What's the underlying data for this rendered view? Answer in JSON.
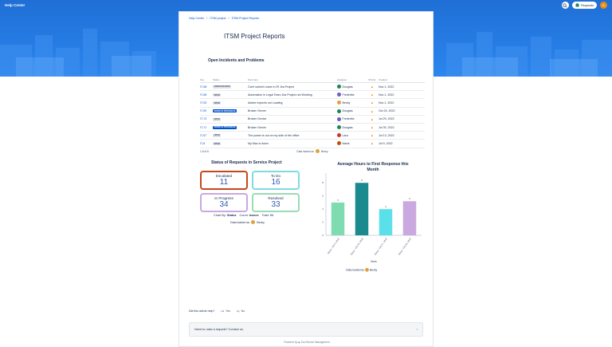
{
  "header": {
    "title": "Help Center",
    "requests_label": "Requests",
    "avatar_initial": "B"
  },
  "breadcrumb": [
    "Help Center",
    "ITSM project",
    "ITSM Project Reports"
  ],
  "page_title": "ITSM Project Reports",
  "table": {
    "title": "Open Incidents and Problems",
    "columns": [
      "Key",
      "Status",
      "Summary",
      "Assignee",
      "Priority",
      "Created"
    ],
    "rows": [
      {
        "key": "IT-98",
        "status": "Under review",
        "summary": "Can't submit Leave in IR Jira Project",
        "assignee": "Douglas",
        "created": "Nov 1, 2022"
      },
      {
        "key": "IT-96",
        "status": "Open",
        "summary": "Automation in Legal Team Jira Project not Working",
        "assignee": "Frederike",
        "created": "Nov 1, 2022"
      },
      {
        "key": "IT-93",
        "status": "Open",
        "summary": "Adobe expects not Loading",
        "assignee": "Becky",
        "created": "Nov 1, 2022"
      },
      {
        "key": "IT-90",
        "status": "Work in progress",
        "summary": "Broken Server",
        "assignee": "Douglas",
        "created": "Oct 24, 2022"
      },
      {
        "key": "IT-73",
        "status": "Open",
        "summary": "Broken Device",
        "assignee": "Frederike",
        "created": "Jul 29, 2022"
      },
      {
        "key": "IT-71",
        "status": "Work in progress",
        "summary": "Broken Server",
        "assignee": "Douglas",
        "created": "Jul 30, 2022"
      },
      {
        "key": "IT-57",
        "status": "Open",
        "summary": "The power is out on my side of the office",
        "assignee": "Lara",
        "created": "Jul 13, 2022"
      },
      {
        "key": "IT-8",
        "status": "Open",
        "summary": "My Mac is down",
        "assignee": "Maria",
        "created": "Jul 9, 2022"
      }
    ],
    "paging": "1-8 of 8",
    "loaded_text": "Data loaded as",
    "loaded_user": "Becky"
  },
  "assignee_colors": {
    "Douglas": "#1f845a",
    "Frederike": "#6e5dc6",
    "Becky": "#e2a03f",
    "Lara": "#c9372c",
    "Maria": "#c25100"
  },
  "status_summary": {
    "title": "Status of Requests in Service Project",
    "boxes": [
      {
        "label": "Escalated",
        "value": "11",
        "color": "#c4471e"
      },
      {
        "label": "To Do",
        "value": "16",
        "color": "#7fdbe0"
      },
      {
        "label": "In Progress",
        "value": "34",
        "color": "#c9a9e0"
      },
      {
        "label": "Resolved",
        "value": "33",
        "color": "#9adcb5"
      }
    ],
    "chart_by_label": "Chart By:",
    "chart_by_value": "Status",
    "count_label": "Count:",
    "count_value": "Issues",
    "total_label": "Total:",
    "total_value": "94",
    "loaded_text": "Data loaded as",
    "loaded_user": "Becky"
  },
  "chart_data": {
    "type": "bar",
    "title": "Average Hours to First Response this Month",
    "categories": [
      "Week - Oct 3, 2022",
      "Week - Oct 10, 2022",
      "Week - Oct 17, 2022",
      "Week - Oct 24, 2022"
    ],
    "values": [
      5,
      8,
      4,
      5.2
    ],
    "data_labels": [
      "5",
      "8",
      "4",
      "5"
    ],
    "colors": [
      "#7fdcb1",
      "#1b8a8e",
      "#5ae0e8",
      "#c9a9e0"
    ],
    "xlabel": "Week",
    "ylabel": "",
    "ylim": [
      0,
      9
    ],
    "yticks": [
      0,
      2,
      4,
      6,
      8
    ],
    "loaded_text": "Data loaded as",
    "loaded_user": "Becky"
  },
  "feedback": {
    "question": "Did this article help?",
    "yes": "Yes",
    "no": "No"
  },
  "contact": {
    "text": "Need to raise a request? Contact us."
  },
  "footer": {
    "powered": "Powered by",
    "product": "Jira Service Management"
  }
}
